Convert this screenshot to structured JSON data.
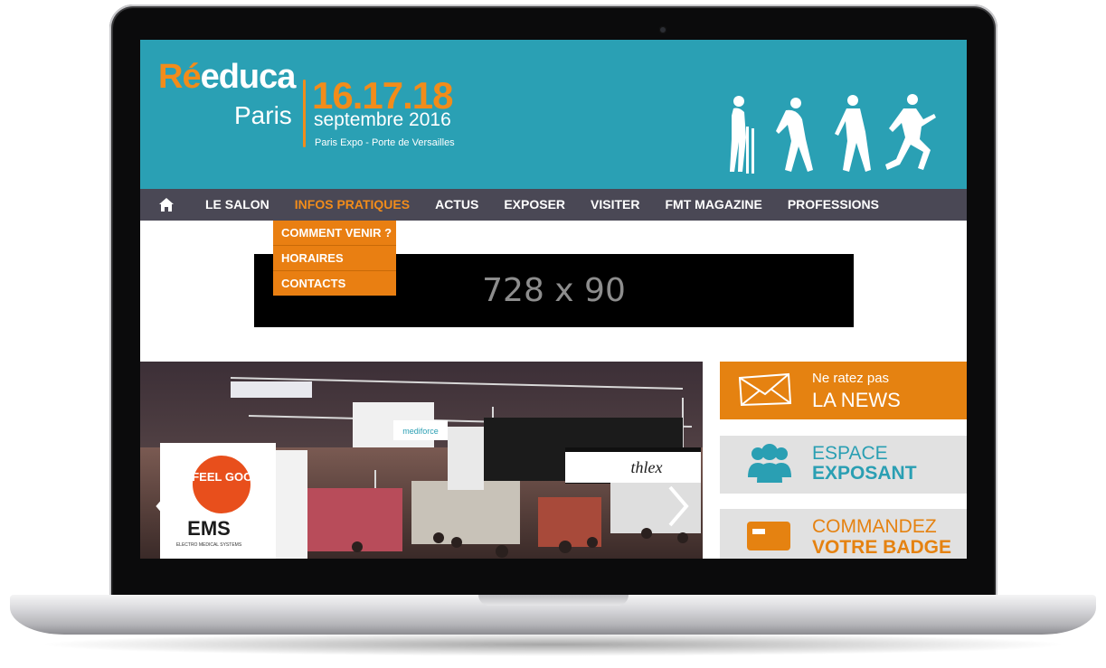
{
  "header": {
    "logo_re": "Ré",
    "logo_educa": "educa",
    "logo_paris": "Paris",
    "dates": "16.17.18",
    "month": "septembre 2016",
    "venue": "Paris Expo - Porte de Versailles"
  },
  "nav": {
    "items": [
      {
        "label": "LE SALON"
      },
      {
        "label": "INFOS PRATIQUES",
        "active": true
      },
      {
        "label": "ACTUS"
      },
      {
        "label": "EXPOSER"
      },
      {
        "label": "VISITER"
      },
      {
        "label": "FMT MAGAZINE"
      },
      {
        "label": "PROFESSIONS"
      }
    ],
    "dropdown": [
      {
        "label": "COMMENT VENIR ?"
      },
      {
        "label": "HORAIRES"
      },
      {
        "label": "CONTACTS"
      }
    ]
  },
  "banner": {
    "text": "728 x 90"
  },
  "slider": {
    "sign_feel_good": "“ I FEEL GOOD”",
    "sign_ems": "EMS",
    "sign_ems_sub": "ELECTRO MEDICAL SYSTEMS",
    "sign_athlex": "thlex",
    "sign_mediforce": "mediforce"
  },
  "side": {
    "news_small": "Ne ratez pas",
    "news_big": "LA NEWS",
    "exposant_1": "ESPACE",
    "exposant_2": "EXPOSANT",
    "badge_1": "COMMANDEZ",
    "badge_2": "VOTRE BADGE"
  },
  "colors": {
    "header_teal": "#2aa0b4",
    "accent_orange": "#f28c1a",
    "nav_dark": "#4a4855"
  }
}
